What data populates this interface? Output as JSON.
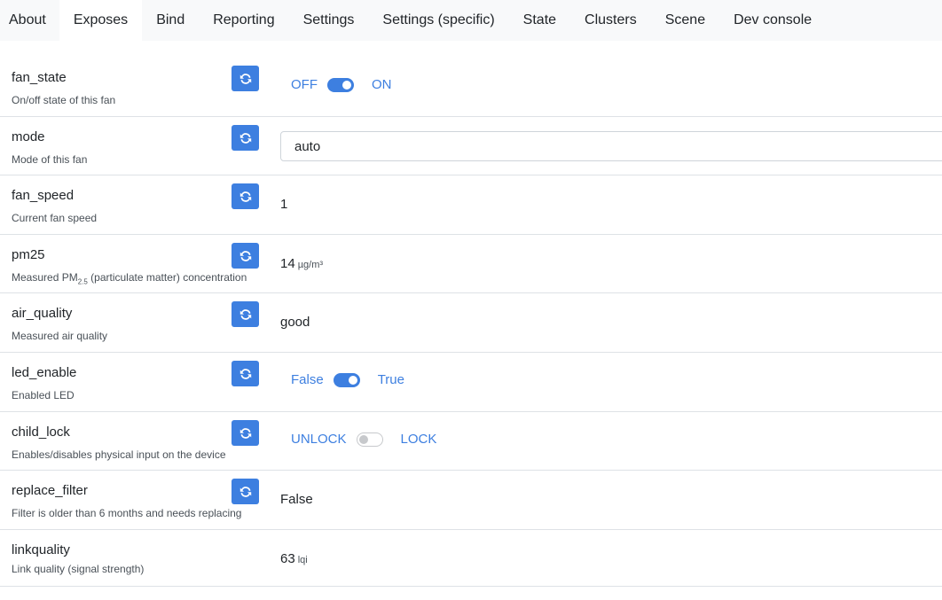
{
  "tabs": [
    {
      "label": "About"
    },
    {
      "label": "Exposes"
    },
    {
      "label": "Bind"
    },
    {
      "label": "Reporting"
    },
    {
      "label": "Settings"
    },
    {
      "label": "Settings (specific)"
    },
    {
      "label": "State"
    },
    {
      "label": "Clusters"
    },
    {
      "label": "Scene"
    },
    {
      "label": "Dev console"
    }
  ],
  "active_tab": "Exposes",
  "rows": {
    "fan_state": {
      "name": "fan_state",
      "description": "On/off state of this fan",
      "off_label": "OFF",
      "on_label": "ON",
      "state": "on"
    },
    "mode": {
      "name": "mode",
      "description": "Mode of this fan",
      "selected": "auto"
    },
    "fan_speed": {
      "name": "fan_speed",
      "description": "Current fan speed",
      "value": "1"
    },
    "pm25": {
      "name": "pm25",
      "description_pre": "Measured PM",
      "description_sub": "2.5",
      "description_post": " (particulate matter) concentration",
      "value": "14",
      "unit": "µg/m³"
    },
    "air_quality": {
      "name": "air_quality",
      "description": "Measured air quality",
      "value": "good"
    },
    "led_enable": {
      "name": "led_enable",
      "description": "Enabled LED",
      "off_label": "False",
      "on_label": "True",
      "state": "on"
    },
    "child_lock": {
      "name": "child_lock",
      "description": "Enables/disables physical input on the device",
      "off_label": "UNLOCK",
      "on_label": "LOCK",
      "state": "off"
    },
    "replace_filter": {
      "name": "replace_filter",
      "description": "Filter is older than 6 months and needs replacing",
      "value": "False"
    },
    "linkquality": {
      "name": "linkquality",
      "description": "Link quality (signal strength)",
      "value": "63",
      "unit": "lqi"
    }
  },
  "colors": {
    "accent": "#3d7fe0",
    "tab_bar": "#f8f9fa",
    "divider": "#dee2e6"
  },
  "icons": {
    "refresh": "refresh-icon"
  }
}
